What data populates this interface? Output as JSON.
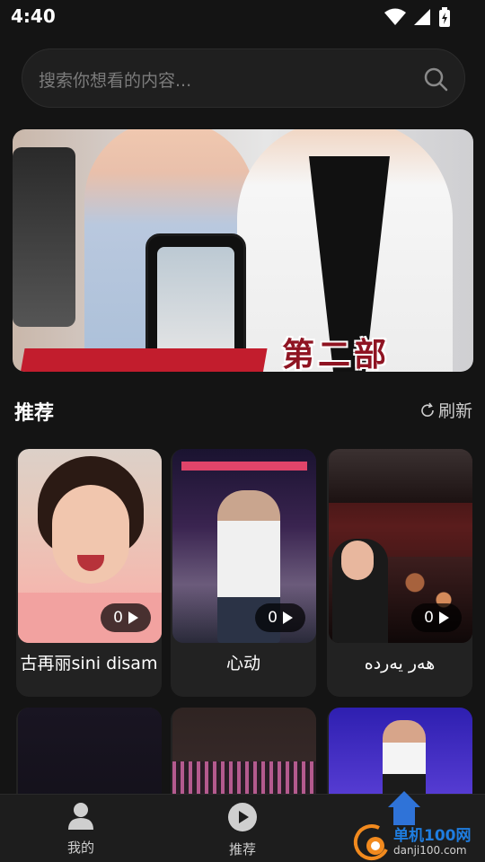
{
  "status_bar": {
    "time": "4:40"
  },
  "search": {
    "placeholder": "搜索你想看的内容..."
  },
  "banner": {
    "title": "第二部"
  },
  "section": {
    "title": "推荐",
    "refresh_label": "刷新"
  },
  "cards": [
    {
      "title": "古再丽sini disam",
      "count": "0"
    },
    {
      "title": "心动",
      "count": "0"
    },
    {
      "title": "ھەر يەردە",
      "count": "0"
    },
    {
      "title": "",
      "count": ""
    },
    {
      "title": "",
      "count": ""
    },
    {
      "title": "",
      "count": ""
    }
  ],
  "bottom_nav": {
    "items": [
      {
        "label": "我的",
        "icon": "person-icon"
      },
      {
        "label": "推荐",
        "icon": "play-icon"
      },
      {
        "label": "",
        "icon": "home-icon"
      }
    ]
  },
  "watermark": {
    "text": "单机100网",
    "sub": "danji100.com"
  },
  "colors": {
    "background": "#141414",
    "accent": "#1f7de0",
    "card": "#222222"
  }
}
